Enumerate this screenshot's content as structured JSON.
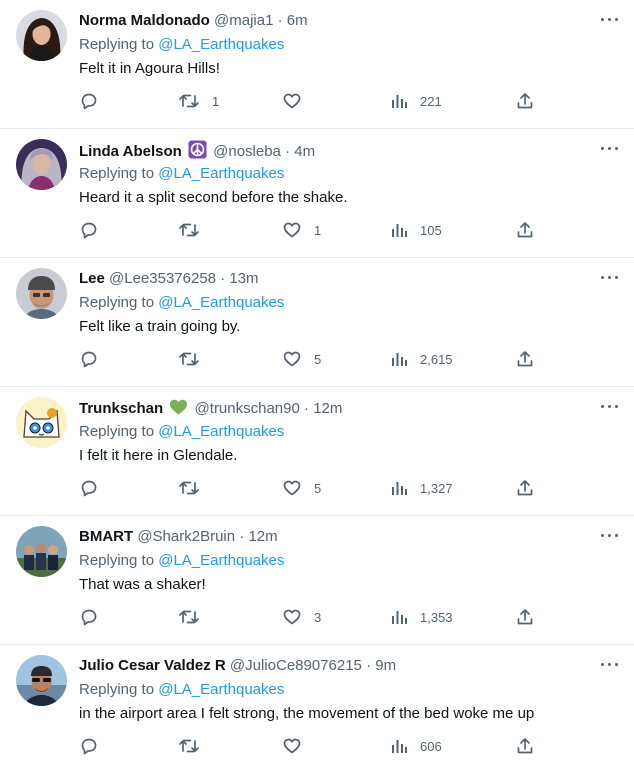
{
  "reply_prefix": "Replying to",
  "colors": {
    "link": "#1d9bf0",
    "muted": "#536471",
    "text": "#0f1419"
  },
  "tweets": [
    {
      "name": "Norma Maldonado",
      "handle": "@majia1",
      "sep": "·",
      "time": "6m",
      "replying_to": "@LA_Earthquakes",
      "text": "Felt it in Agoura Hills!",
      "replies": "",
      "retweets": "1",
      "likes": "",
      "views": "221",
      "avatar": "avatar-woman-dark-hair"
    },
    {
      "name": "Linda Abelson",
      "badge_icon": "peace-sign-icon",
      "handle": "@nosleba",
      "sep": "·",
      "time": "4m",
      "replying_to": "@LA_Earthquakes",
      "text": "Heard it a split second before the shake.",
      "replies": "",
      "retweets": "",
      "likes": "1",
      "views": "105",
      "avatar": "avatar-woman-gray-hair"
    },
    {
      "name": "Lee",
      "handle": "@Lee35376258",
      "sep": "·",
      "time": "13m",
      "replying_to": "@LA_Earthquakes",
      "text": "Felt like a train going by.",
      "replies": "",
      "retweets": "",
      "likes": "5",
      "views": "2,615",
      "avatar": "avatar-man-cap"
    },
    {
      "name": "Trunkschan",
      "badge_icon": "green-heart-icon",
      "handle": "@trunkschan90",
      "sep": "·",
      "time": "12m",
      "replying_to": "@LA_Earthquakes",
      "text": "I felt it here in Glendale.",
      "replies": "",
      "retweets": "",
      "likes": "5",
      "views": "1,327",
      "avatar": "avatar-cartoon-cat"
    },
    {
      "name": "BMART",
      "handle": "@Shark2Bruin",
      "sep": "·",
      "time": "12m",
      "replying_to": "@LA_Earthquakes",
      "text": "That was a shaker!",
      "replies": "",
      "retweets": "",
      "likes": "3",
      "views": "1,353",
      "avatar": "avatar-group-photo"
    },
    {
      "name": "Julio Cesar Valdez R",
      "handle": "@JulioCe89076215",
      "sep": "·",
      "time": "9m",
      "replying_to": "@LA_Earthquakes",
      "text": "in the airport area I felt strong, the movement of the bed woke me up",
      "replies": "",
      "retweets": "",
      "likes": "",
      "views": "606",
      "avatar": "avatar-man-sunglasses"
    }
  ]
}
